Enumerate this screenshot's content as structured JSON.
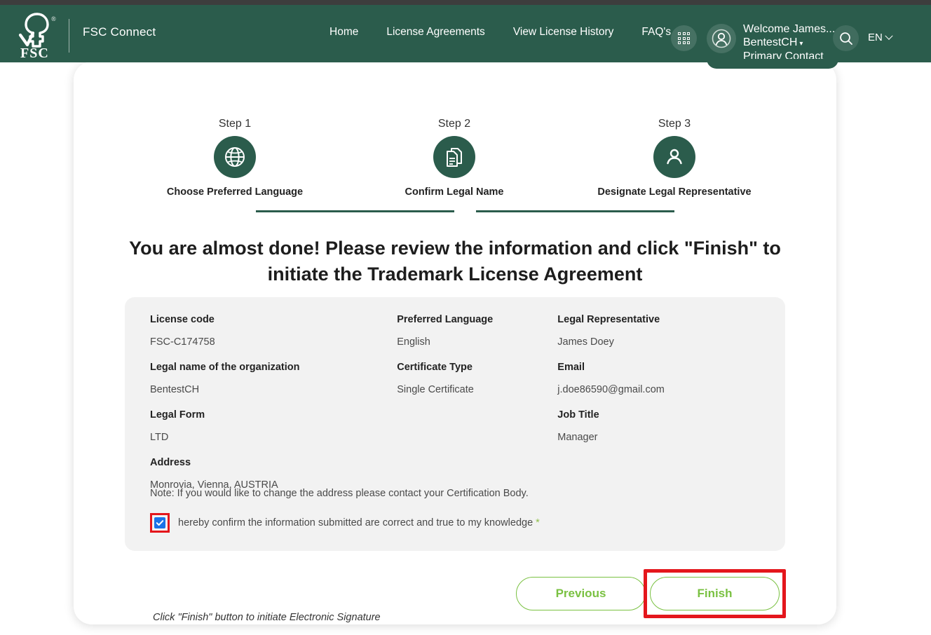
{
  "header": {
    "brand": "FSC Connect",
    "logo_text": "FSC",
    "logo_registered": "®",
    "nav": [
      {
        "label": "Home"
      },
      {
        "label": "License Agreements"
      },
      {
        "label": "View License History"
      },
      {
        "label": "FAQ's"
      }
    ],
    "apps_icon": "grid-icon",
    "avatar_icon": "user-avatar-icon",
    "search_icon": "search-icon",
    "user": {
      "line1": "Welcome James...",
      "line2": "BentestCH",
      "caret": "▾",
      "line3": "Primary Contact"
    },
    "language": {
      "label": "EN",
      "chevron": "chevron-down-icon"
    }
  },
  "stepper": {
    "steps": [
      {
        "label": "Step 1",
        "title": "Choose Preferred Language",
        "icon": "globe-icon"
      },
      {
        "label": "Step 2",
        "title": "Confirm Legal Name",
        "icon": "documents-icon"
      },
      {
        "label": "Step 3",
        "title": "Designate Legal Representative",
        "icon": "person-icon"
      }
    ]
  },
  "main": {
    "headline": "You are almost done! Please review the information and click \"Finish\" to initiate the Trademark License Agreement",
    "info": {
      "column_1": [
        {
          "label": "License code",
          "value": "FSC-C174758"
        },
        {
          "label": "Legal name of the organization",
          "value": "BentestCH"
        },
        {
          "label": "Legal Form",
          "value": "LTD"
        },
        {
          "label": "Address",
          "value": "Monrovia, Vienna, AUSTRIA"
        }
      ],
      "column_2": [
        {
          "label": "Preferred Language",
          "value": "English"
        },
        {
          "label": "Certificate Type",
          "value": "Single Certificate"
        }
      ],
      "column_3": [
        {
          "label": "Legal Representative",
          "value": "James Doey"
        },
        {
          "label": "Email",
          "value": "j.doe86590@gmail.com"
        },
        {
          "label": "Job Title",
          "value": "Manager"
        }
      ],
      "note": "Note: If you would like to change the address please contact your Certification Body.",
      "confirm_text": "hereby confirm the information submitted are correct and true to my knowledge",
      "required_marker": "*",
      "confirm_checked": true
    },
    "hint": "Click \"Finish\" button to initiate Electronic Signature",
    "buttons": {
      "previous": "Previous",
      "finish": "Finish"
    }
  },
  "colors": {
    "header_green": "#2b5c4c",
    "accent_green": "#7ac142",
    "highlight_red": "#e4161c",
    "checkbox_blue": "#1a73e8",
    "card_grey": "#f2f2f2"
  }
}
